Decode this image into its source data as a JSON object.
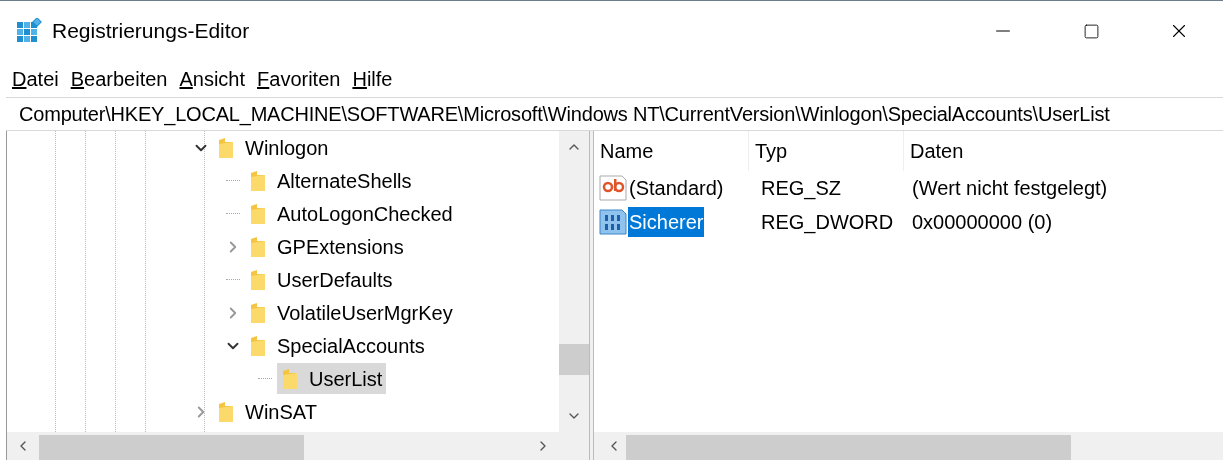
{
  "window": {
    "title": "Registrierungs-Editor"
  },
  "menu": [
    "Datei",
    "Bearbeiten",
    "Ansicht",
    "Favoriten",
    "Hilfe"
  ],
  "address": "Computer\\HKEY_LOCAL_MACHINE\\SOFTWARE\\Microsoft\\Windows NT\\CurrentVersion\\Winlogon\\SpecialAccounts\\UserList",
  "tree": [
    {
      "label": "Winlogon",
      "expanded": true,
      "selected": false,
      "children": [
        {
          "label": "AlternateShells",
          "selected": false
        },
        {
          "label": "AutoLogonChecked",
          "selected": false
        },
        {
          "label": "GPExtensions",
          "expanded": false,
          "selected": false
        },
        {
          "label": "UserDefaults",
          "selected": false
        },
        {
          "label": "VolatileUserMgrKey",
          "expanded": false,
          "selected": false
        },
        {
          "label": "SpecialAccounts",
          "expanded": true,
          "selected": false,
          "children": [
            {
              "label": "UserList",
              "selected": true
            }
          ]
        }
      ]
    },
    {
      "label": "WinSAT",
      "expanded": false,
      "selected": false
    }
  ],
  "table": {
    "columns": [
      "Name",
      "Typ",
      "Daten"
    ],
    "rows": [
      {
        "kind": "string",
        "name": "(Standard)",
        "type": "REG_SZ",
        "data": "(Wert nicht festgelegt)",
        "selected": false
      },
      {
        "kind": "dword",
        "name": "Sicherer",
        "type": "REG_DWORD",
        "data": "0x00000000 (0)",
        "selected": true
      }
    ]
  }
}
